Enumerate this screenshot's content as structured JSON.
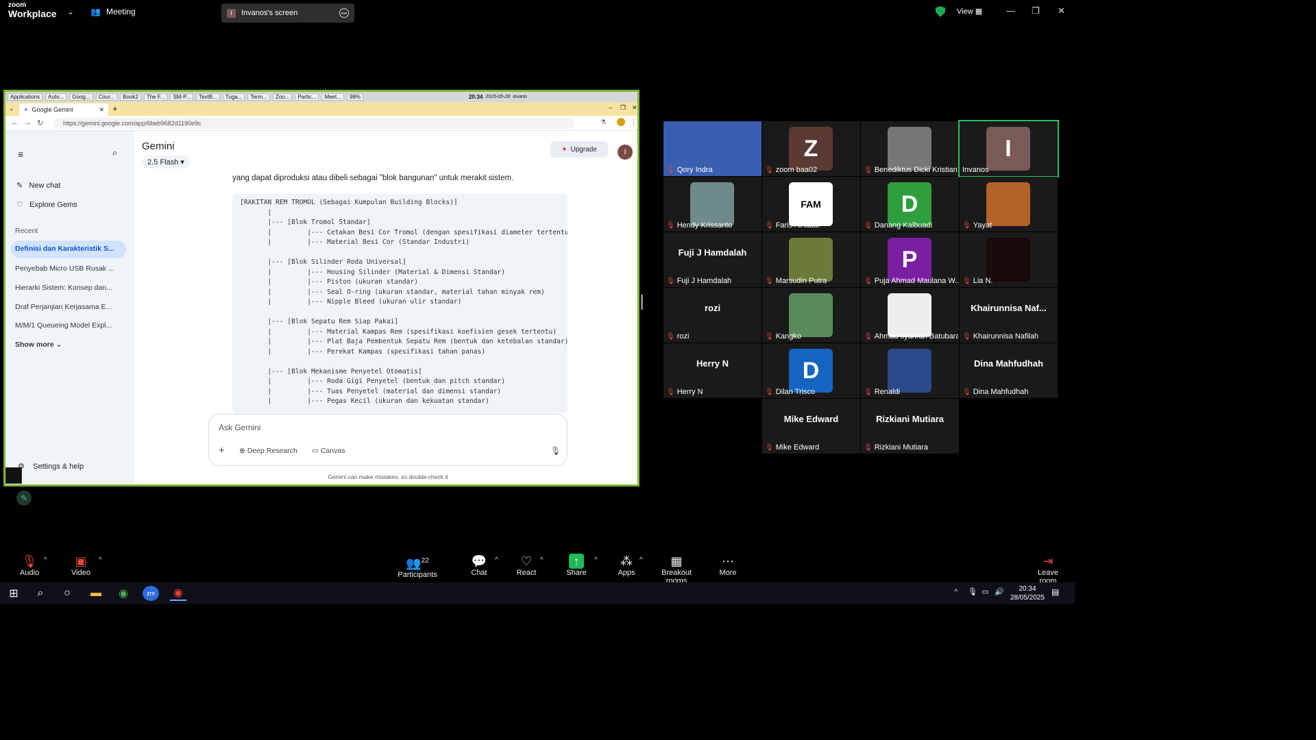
{
  "topbar": {
    "logo_small": "zoom",
    "logo_big": "Workplace",
    "meeting_label": "Meeting",
    "screen_owner_initial": "I",
    "screen_label": "Invanos's screen",
    "view_label": "View",
    "shield_color": "#1fa84f"
  },
  "shared_screen": {
    "linux_taskbar": [
      "Applications",
      "Auto...",
      "Goog...",
      "Cour...",
      "Book2",
      "The F...",
      "SM-P...",
      "TextB...",
      "Tuga...",
      "Term...",
      "Zoo...",
      "Partic...",
      "Meet...",
      "98%"
    ],
    "linux_clock": "20:34",
    "linux_date": "2025-05-28",
    "linux_user": "invano",
    "browser_tab": "Google Gemini",
    "url": "https://gemini.google.com/app/6beb9682d1190e9c",
    "gemini": {
      "title": "Gemini",
      "model": "2.5 Flash",
      "upgrade_label": "Upgrade",
      "avatar_initial": "I",
      "new_chat": "New chat",
      "explore_gems": "Explore Gems",
      "recent_heading": "Recent",
      "recent_items": [
        "Definisi dan Karakteristik S...",
        "Penyebab Micro USB Rusak ...",
        "Hierarki Sistem: Konsep dan...",
        "Draf Perjanjian Kerjasama E...",
        "M/M/1 Queueing Model Expl..."
      ],
      "show_more": "Show more",
      "settings": "Settings & help",
      "intro_text": "yang dapat diproduksi atau dibeli sebagai \"blok bangunan\" untuk merakit sistem.",
      "code_block": "[RAKITAN REM TROMOL (Sebagai Kumpulan Building Blocks)]\n       |\n       |--- [Blok Tromol Standar]\n       |         |--- Cetakan Besi Cor Tromol (dengan spesifikasi diameter tertentu\n       |         |--- Material Besi Cor (Standar Industri)\n\n       |--- [Blok Silinder Roda Universal]\n       |         |--- Housing Silinder (Material & Dimensi Standar)\n       |         |--- Piston (ukuran standar)\n       |         |--- Seal O-ring (ukuran standar, material tahan minyak rem)\n       |         |--- Nipple Bleed (ukuran ulir standar)\n\n       |--- [Blok Sepatu Rem Siap Pakai]\n       |         |--- Material Kampas Rem (spesifikasi koefisien gesek tertentu)\n       |         |--- Plat Baja Pembentuk Sepatu Rem (bentuk dan ketebalan standar)\n       |         |--- Perekat Kampas (spesifikasi tahan panas)\n\n       |--- [Blok Mekanisme Penyetel Otomatis]\n       |         |--- Roda Gigi Penyetel (bentuk dan pitch standar)\n       |         |--- Tuas Penyetel (material dan dimensi standar)\n       |         |--- Pegas Kecil (ukuran dan kekuatan standar)",
      "ask_placeholder": "Ask Gemini",
      "deep_research": "Deep Research",
      "canvas": "Canvas",
      "disclaimer": "Gemini can make mistakes, so double-check it"
    }
  },
  "participants": [
    {
      "name": "Qory Indra",
      "type": "photo",
      "color": "#3a5fb0"
    },
    {
      "name": "zoom baa02",
      "type": "initial",
      "initial": "Z",
      "color": "#5a3a33"
    },
    {
      "name": "Benediktus Dicki Kristian",
      "type": "photo",
      "color": "#777777"
    },
    {
      "name": "Invanos",
      "type": "initial",
      "initial": "I",
      "color": "#7a5a55",
      "active": true
    },
    {
      "name": "Hendy Krissanto",
      "type": "photo",
      "color": "#6f8a8a"
    },
    {
      "name": "Faris Alhaadi",
      "type": "logo",
      "initial": "FAM",
      "color": "#ffffff"
    },
    {
      "name": "Danang Kalbuadi",
      "type": "initial",
      "initial": "D",
      "color": "#2e9e3e"
    },
    {
      "name": "Yayat",
      "type": "photo",
      "color": "#b4622a"
    },
    {
      "name": "Fuji J Hamdalah",
      "type": "text",
      "display": "Fuji J Hamdalah"
    },
    {
      "name": "Marsudin Putra",
      "type": "photo",
      "color": "#6a7a3a"
    },
    {
      "name": "Puja Ahmad Maulana W...",
      "type": "initial",
      "initial": "P",
      "color": "#7b1fa2"
    },
    {
      "name": "Lia N.",
      "type": "photo",
      "color": "#1a0a0a"
    },
    {
      "name": "rozi",
      "type": "text",
      "display": "rozi"
    },
    {
      "name": "Kangko",
      "type": "photo",
      "color": "#5a8a5a"
    },
    {
      "name": "Ahmad syahran Batubara",
      "type": "photo",
      "color": "#eeeeee"
    },
    {
      "name": "Khairunnisa Nafilah",
      "type": "text",
      "display": "Khairunnisa  Naf..."
    },
    {
      "name": "Herry N",
      "type": "text",
      "display": "Herry N"
    },
    {
      "name": "Dilan Trisco",
      "type": "initial",
      "initial": "D",
      "color": "#1565c0"
    },
    {
      "name": "Renaldi",
      "type": "photo",
      "color": "#2a4a8a"
    },
    {
      "name": "Dina Mahfudhah",
      "type": "text",
      "display": "Dina Mahfudhah"
    },
    {
      "name": "Mike Edward",
      "type": "text",
      "display": "Mike Edward"
    },
    {
      "name": "Rizkiani Mutiara",
      "type": "text",
      "display": "Rizkiani Mutiara"
    }
  ],
  "toolbar": {
    "audio": "Audio",
    "video": "Video",
    "participants_count": "22",
    "participants": "Participants",
    "chat": "Chat",
    "react": "React",
    "share": "Share",
    "apps": "Apps",
    "breakout": "Breakout rooms",
    "more": "More",
    "leave": "Leave room",
    "share_color": "#1fb955"
  },
  "windows_taskbar": {
    "time": "20:34",
    "date": "28/05/2025"
  }
}
